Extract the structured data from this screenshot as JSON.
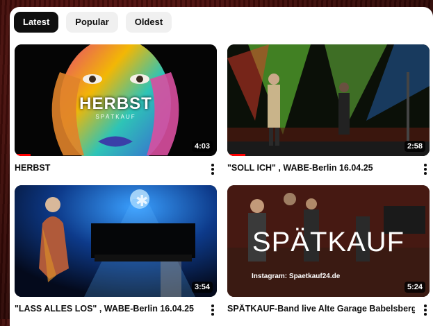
{
  "tabs": [
    {
      "label": "Latest",
      "active": true
    },
    {
      "label": "Popular",
      "active": false
    },
    {
      "label": "Oldest",
      "active": false
    }
  ],
  "videos": [
    {
      "title": "HERBST",
      "duration": "4:03",
      "overlay_title": "HERBST",
      "overlay_sub": "SPÄTKAUF",
      "watched": 0.08
    },
    {
      "title": "\"SOLL ICH\" , WABE-Berlin 16.04.25",
      "duration": "2:58",
      "watched": 0.09
    },
    {
      "title": "\"LASS ALLES LOS\" , WABE-Berlin 16.04.25",
      "duration": "3:54",
      "watched": 0
    },
    {
      "title": "SPÄTKAUF-Band live Alte Garage Babelsberg",
      "duration": "5:24",
      "overlay_title": "SPÄTKAUF",
      "overlay_sub": "Instagram: Spaetkauf24.de",
      "watched": 0
    }
  ],
  "colors": {
    "accent": "#ff0000",
    "chip_active": "#0f0f0f",
    "chip_bg": "#f0f0f0"
  }
}
